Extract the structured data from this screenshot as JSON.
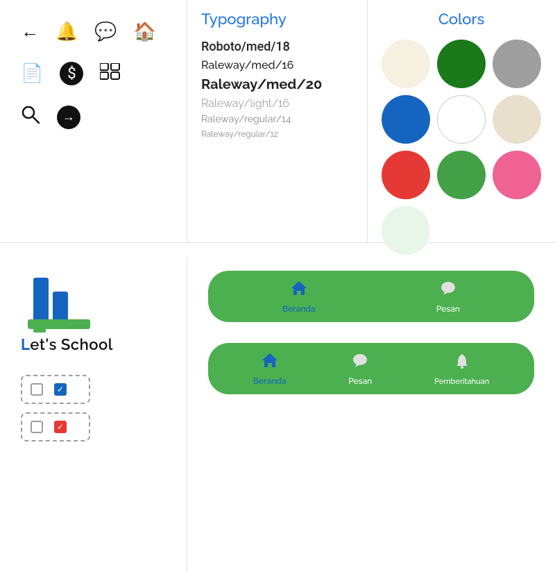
{
  "header": {
    "typography_title": "Typography",
    "colors_title": "Colors"
  },
  "typography": {
    "items": [
      {
        "label": "Roboto/med/18",
        "class": "typo-roboto-med-18"
      },
      {
        "label": "Raleway/med/16",
        "class": "typo-raleway-med-16"
      },
      {
        "label": "Raleway/med/20",
        "class": "typo-raleway-med-20"
      },
      {
        "label": "Raleway/light/16",
        "class": "typo-raleway-light-16"
      },
      {
        "label": "Raleway/regular/14",
        "class": "typo-raleway-regular-14"
      },
      {
        "label": "Raleway/regular/12",
        "class": "typo-raleway-regular-12"
      }
    ]
  },
  "colors": [
    {
      "name": "beige",
      "class": "color-beige"
    },
    {
      "name": "dark-green",
      "class": "color-dark-green"
    },
    {
      "name": "gray",
      "class": "color-gray"
    },
    {
      "name": "blue",
      "class": "color-blue"
    },
    {
      "name": "white",
      "class": "color-white"
    },
    {
      "name": "light-beige",
      "class": "color-light-beige"
    },
    {
      "name": "red",
      "class": "color-red"
    },
    {
      "name": "green",
      "class": "color-green"
    },
    {
      "name": "pink",
      "class": "color-pink"
    },
    {
      "name": "light-green",
      "class": "color-light-green"
    }
  ],
  "logo": {
    "text": "et's School",
    "prefix": "L"
  },
  "nav_bar_2": {
    "items": [
      {
        "label": "Beranda",
        "active": true,
        "icon": "🏠"
      },
      {
        "label": "Pesan",
        "active": false,
        "icon": "💬"
      }
    ]
  },
  "nav_bar_3": {
    "items": [
      {
        "label": "Beranda",
        "active": true,
        "icon": "🏠"
      },
      {
        "label": "Pesan",
        "active": false,
        "icon": "💬"
      },
      {
        "label": "Pemberitahuan",
        "active": false,
        "icon": "🔔"
      }
    ]
  },
  "icons": {
    "row1": [
      "←",
      "🔔",
      "💬",
      "🏠"
    ],
    "row2": [
      "📄",
      "$",
      "⊞",
      ""
    ],
    "row3": [
      "🔍",
      "→"
    ]
  }
}
